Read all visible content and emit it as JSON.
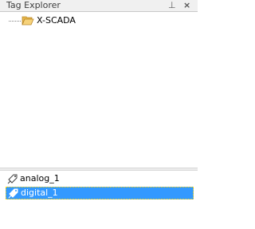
{
  "window": {
    "title": "Tag Explorer",
    "pin_glyph": "ј",
    "close_glyph": "×"
  },
  "tree": {
    "root": {
      "label": "X-SCADA",
      "icon": "folder-open-icon"
    }
  },
  "tags": {
    "items": [
      {
        "label": "analog_1",
        "icon": "tag-icon",
        "selected": false
      },
      {
        "label": "digital_1",
        "icon": "tag-icon",
        "selected": true
      }
    ]
  },
  "colors": {
    "selection": "#3399ff",
    "folder": "#f2c94c"
  }
}
